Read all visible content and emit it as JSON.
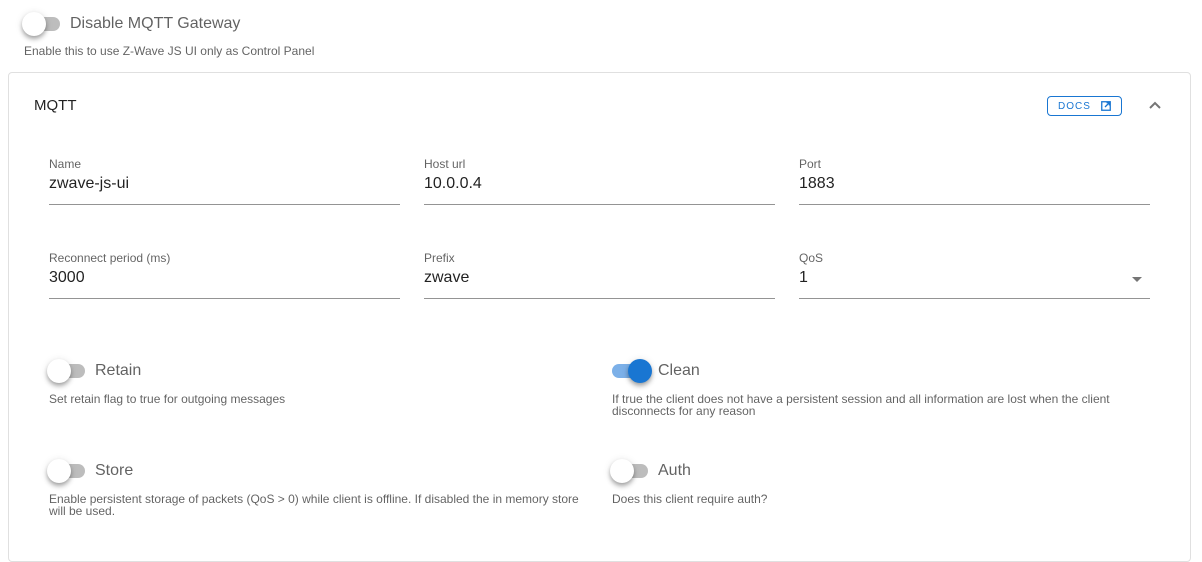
{
  "gateway": {
    "toggle_label": "Disable MQTT Gateway",
    "toggle_on": false,
    "hint": "Enable this to use Z-Wave JS UI only as Control Panel"
  },
  "panel": {
    "title": "MQTT",
    "docs_label": "DOCS",
    "docs_icon": "open-in-new-icon",
    "collapse_icon": "chevron-up-icon"
  },
  "fields": {
    "name": {
      "label": "Name",
      "value": "zwave-js-ui"
    },
    "host": {
      "label": "Host url",
      "value": "10.0.0.4"
    },
    "port": {
      "label": "Port",
      "value": "1883"
    },
    "reconnect": {
      "label": "Reconnect period (ms)",
      "value": "3000"
    },
    "prefix": {
      "label": "Prefix",
      "value": "zwave"
    },
    "qos": {
      "label": "QoS",
      "value": "1"
    }
  },
  "options": {
    "retain": {
      "label": "Retain",
      "on": false,
      "hint": "Set retain flag to true for outgoing messages"
    },
    "clean": {
      "label": "Clean",
      "on": true,
      "hint": "If true the client does not have a persistent session and all information are lost when the client disconnects for any reason"
    },
    "store": {
      "label": "Store",
      "on": false,
      "hint": "Enable persistent storage of packets (QoS > 0) while client is offline. If disabled the in memory store will be used."
    },
    "auth": {
      "label": "Auth",
      "on": false,
      "hint": "Does this client require auth?"
    }
  },
  "colors": {
    "primary": "#1976d2",
    "switch_off_track": "#bdbdbd",
    "switch_on_track": "#7cb0e8"
  }
}
